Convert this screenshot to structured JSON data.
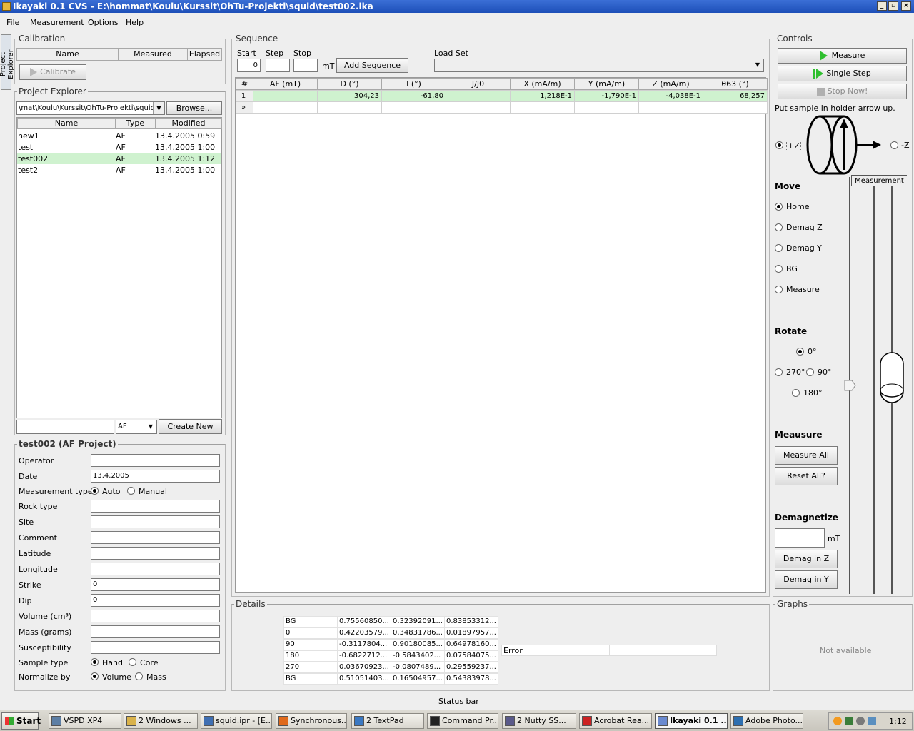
{
  "window": {
    "title": "Ikayaki 0.1 CVS - E:\\hommat\\Koulu\\Kurssit\\OhTu-Projekti\\squid\\test002.ika"
  },
  "menu": [
    "File",
    "Measurement",
    "Options",
    "Help"
  ],
  "side_tab": "Project Explorer",
  "calibration": {
    "title": "Calibration",
    "columns": [
      "Name",
      "Measured",
      "Elapsed"
    ],
    "calibrate_label": "Calibrate"
  },
  "explorer": {
    "title": "Project Explorer",
    "path": "\\mat\\Koulu\\Kurssit\\OhTu-Projekti\\squid",
    "browse_label": "Browse...",
    "columns": [
      "Name",
      "Type",
      "Modified"
    ],
    "rows": [
      {
        "name": "new1",
        "type": "AF",
        "modified": "13.4.2005 0:59"
      },
      {
        "name": "test",
        "type": "AF",
        "modified": "13.4.2005 1:00"
      },
      {
        "name": "test002",
        "type": "AF",
        "modified": "13.4.2005 1:12"
      },
      {
        "name": "test2",
        "type": "AF",
        "modified": "13.4.2005 1:00"
      }
    ],
    "selected_row": 2,
    "new_type": "AF",
    "create_label": "Create New"
  },
  "project": {
    "title": "test002 (AF Project)",
    "fields": [
      {
        "label": "Operator",
        "value": ""
      },
      {
        "label": "Date",
        "value": "13.4.2005"
      }
    ],
    "measurement_type_label": "Measurement type",
    "measurement_type_options": [
      "Auto",
      "Manual"
    ],
    "fields2": [
      {
        "label": "Rock type",
        "value": ""
      },
      {
        "label": "Site",
        "value": ""
      },
      {
        "label": "Comment",
        "value": ""
      },
      {
        "label": "Latitude",
        "value": ""
      },
      {
        "label": "Longitude",
        "value": ""
      },
      {
        "label": "Strike",
        "value": "0"
      },
      {
        "label": "Dip",
        "value": "0"
      },
      {
        "label": "Volume (cm³)",
        "value": ""
      },
      {
        "label": "Mass (grams)",
        "value": ""
      },
      {
        "label": "Susceptibility",
        "value": ""
      }
    ],
    "sample_type_label": "Sample type",
    "sample_type_options": [
      "Hand",
      "Core"
    ],
    "normalize_label": "Normalize by",
    "normalize_options": [
      "Volume",
      "Mass"
    ]
  },
  "sequence": {
    "title": "Sequence",
    "start_label": "Start",
    "start_value": "0",
    "step_label": "Step",
    "step_value": "",
    "stop_label": "Stop",
    "stop_value": "",
    "unit": "mT",
    "add_label": "Add Sequence",
    "loadset_label": "Load Set",
    "columns": [
      "#",
      "AF (mT)",
      "D (°)",
      "I (°)",
      "J/J0",
      "X (mA/m)",
      "Y (mA/m)",
      "Z (mA/m)",
      "θ63 (°)"
    ],
    "rows": [
      [
        "1",
        "",
        "304,23",
        "-61,80",
        "",
        "1,218E-1",
        "-1,790E-1",
        "-4,038E-1",
        "68,257"
      ],
      [
        "»",
        "",
        "",
        "",
        "",
        "",
        "",
        "",
        ""
      ]
    ]
  },
  "details": {
    "title": "Details",
    "rows": [
      [
        "BG",
        "0.75560850...",
        "0.32392091...",
        "0.83853312..."
      ],
      [
        "0",
        "0.42203579...",
        "0.34831786...",
        "0.01897957..."
      ],
      [
        "90",
        "-0.3117804...",
        "0.90180085...",
        "0.64978160..."
      ],
      [
        "180",
        "-0.6822712...",
        "-0.5843402...",
        "0.07584075..."
      ],
      [
        "270",
        "0.03670923...",
        "-0.0807489...",
        "0.29559237..."
      ],
      [
        "BG",
        "0.51051403...",
        "0.16504957...",
        "0.54383978..."
      ]
    ],
    "error_label": "Error"
  },
  "controls": {
    "title": "Controls",
    "measure_label": "Measure",
    "single_step_label": "Single Step",
    "stop_label": "Stop Now!",
    "hint": "Put sample in holder arrow up.",
    "plus_z": "+Z",
    "minus_z": "-Z",
    "measurement_caption": "Measurement",
    "move_title": "Move",
    "move_options": [
      "Home",
      "Demag Z",
      "Demag Y",
      "BG",
      "Measure"
    ],
    "rotate_title": "Rotate",
    "rotate_options": {
      "r0": "0°",
      "r270": "270°",
      "r90": "90°",
      "r180": "180°"
    },
    "measure_title": "Meausure",
    "measure_all_label": "Measure All",
    "reset_all_label": "Reset All?",
    "demag_title": "Demagnetize",
    "demag_unit": "mT",
    "demag_z_label": "Demag in Z",
    "demag_y_label": "Demag in Y"
  },
  "graphs": {
    "title": "Graphs",
    "placeholder": "Not available"
  },
  "status_bar": "Status bar",
  "taskbar": {
    "start": "Start",
    "items": [
      "VSPD XP4",
      "2 Windows ...",
      "squid.ipr - [E...",
      "Synchronous...",
      "2 TextPad",
      "Command Pr...",
      "2 Nutty SS...",
      "Acrobat Rea...",
      "Ikayaki 0.1 ...",
      "Adobe Photo..."
    ],
    "clock": "1:12"
  }
}
